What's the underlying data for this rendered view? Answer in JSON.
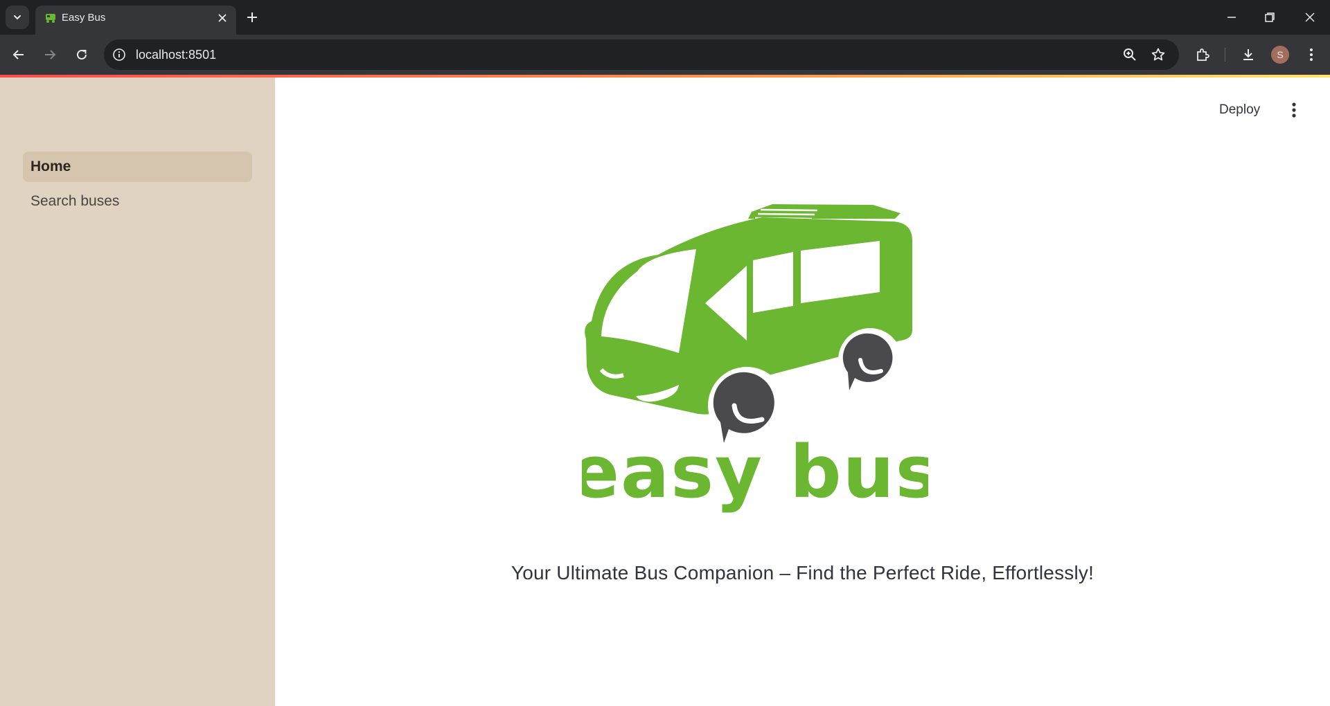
{
  "browser": {
    "tab_title": "Easy Bus",
    "url": "localhost:8501",
    "profile_initial": "S"
  },
  "app": {
    "sidebar": {
      "items": [
        {
          "label": "Home",
          "active": true
        },
        {
          "label": "Search buses",
          "active": false
        }
      ]
    },
    "header": {
      "deploy_label": "Deploy"
    },
    "logo": {
      "wordmark": "easy bus",
      "color": "#6bb731"
    },
    "tagline": "Your Ultimate Bus Companion – Find the Perfect Ride, Effortlessly!"
  },
  "colors": {
    "sidebar_bg": "#e0d3c2",
    "active_item_bg": "#d6c5ae",
    "brand_green": "#6bb731",
    "wheel_gray": "#4a4a4c"
  }
}
